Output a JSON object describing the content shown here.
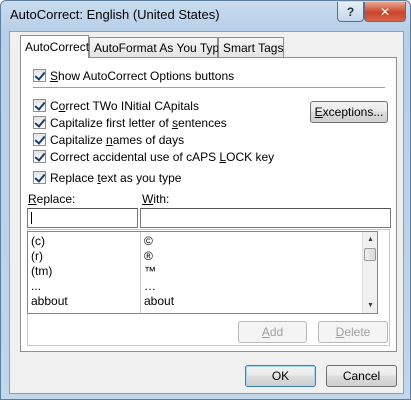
{
  "window": {
    "title": "AutoCorrect: English (United States)",
    "help_glyph": "?",
    "close_glyph": "✕"
  },
  "tabs": [
    {
      "label": "AutoCorrect",
      "active": true
    },
    {
      "label": "AutoFormat As You Type",
      "active": false
    },
    {
      "label": "Smart Tags",
      "active": false
    }
  ],
  "options": {
    "show_buttons": {
      "pre": "",
      "u": "S",
      "post": "how AutoCorrect Options buttons",
      "checked": true
    },
    "correct_two_initial": {
      "pre": "C",
      "u": "o",
      "post": "rrect TWo INitial CApitals",
      "checked": true
    },
    "capitalize_first": {
      "pre": "Capitalize first letter of ",
      "u": "s",
      "post": "entences",
      "checked": true
    },
    "capitalize_days": {
      "pre": "Capitalize ",
      "u": "n",
      "post": "ames of days",
      "checked": true
    },
    "caps_lock": {
      "pre": "Correct accidental use of cAPS ",
      "u": "L",
      "post": "OCK key",
      "checked": true
    },
    "replace_as_you_type": {
      "pre": "Replace ",
      "u": "t",
      "post": "ext as you type",
      "checked": true
    }
  },
  "buttons": {
    "exceptions": {
      "u": "E",
      "rest": "xceptions..."
    },
    "add": {
      "u": "A",
      "rest": "dd"
    },
    "delete": {
      "u": "D",
      "rest": "elete"
    },
    "ok": "OK",
    "cancel": "Cancel"
  },
  "replace_fields": {
    "replace_label": {
      "u": "R",
      "rest": "eplace:"
    },
    "with_label": {
      "u": "W",
      "rest": "ith:"
    },
    "replace_value": "",
    "with_value": ""
  },
  "list": {
    "rows": [
      {
        "replace": "(c)",
        "with": "©"
      },
      {
        "replace": "(r)",
        "with": "®"
      },
      {
        "replace": "(tm)",
        "with": "™"
      },
      {
        "replace": "...",
        "with": "…"
      },
      {
        "replace": "abbout",
        "with": "about"
      }
    ],
    "scroll_up": "▲",
    "scroll_down": "▼"
  },
  "colors": {
    "title_bar": "#c2d6ec",
    "close_button": "#c9452c",
    "dialog_face": "#f0f0f0",
    "check_mark": "#1c3e6e"
  }
}
